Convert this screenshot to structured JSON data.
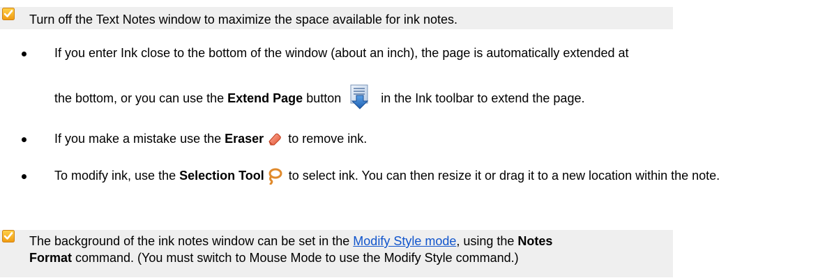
{
  "tip1": {
    "icon": "check-icon",
    "text": "Turn off the Text Notes window to maximize the space available for ink notes."
  },
  "bullets": [
    {
      "line1": "If you enter Ink close to the bottom of the window (about an inch), the page is automatically extended at",
      "line2_prefix": "the bottom, or you can use the ",
      "line2_bold": "Extend Page",
      "line2_mid": " button",
      "line2_suffix": " in the Ink toolbar to extend the page.",
      "icon": "extend-page-icon"
    },
    {
      "prefix": "If you make a mistake use the ",
      "bold": "Eraser",
      "suffix": " to remove ink.",
      "icon": "eraser-icon"
    },
    {
      "prefix": "To modify ink, use the ",
      "bold": "Selection Tool",
      "suffix": " to select ink. You can then resize it or drag it to a new location within the note.",
      "icon": "lasso-icon"
    }
  ],
  "tip2": {
    "icon": "check-icon",
    "prefix": "The background of the ink notes window can be set in the ",
    "link": "Modify Style mode",
    "mid": ", using the ",
    "bold1": "Notes",
    "bold2": "Format",
    "suffix": " command. (You must switch to Mouse Mode to use the Modify Style command.)"
  },
  "colors": {
    "tip_background": "#efefef",
    "check_orange": "#f0a020",
    "link": "#1155cc"
  }
}
